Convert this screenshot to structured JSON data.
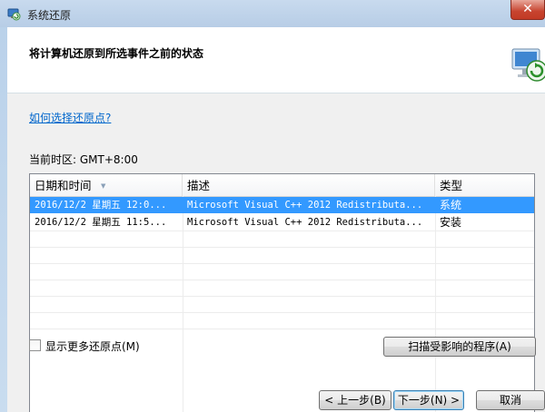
{
  "window": {
    "title": "系统还原",
    "close_glyph": "✕"
  },
  "header": {
    "title": "将计算机还原到所选事件之前的状态",
    "icon": "system-restore-icon"
  },
  "help_link": "如何选择还原点?",
  "timezone_label": "当前时区: GMT+8:00",
  "table": {
    "columns": [
      "日期和时间",
      "描述",
      "类型"
    ],
    "rows": [
      {
        "date": "2016/12/2 星期五 12:0...",
        "description": "Microsoft Visual C++ 2012 Redistributa...",
        "type": "系统",
        "selected": true
      },
      {
        "date": "2016/12/2 星期五 11:5...",
        "description": "Microsoft Visual C++ 2012 Redistributa...",
        "type": "安装",
        "selected": false
      }
    ]
  },
  "show_more_label": "显示更多还原点(M)",
  "show_more_checked": false,
  "buttons": {
    "scan": "扫描受影响的程序(A)",
    "back": "< 上一步(B)",
    "next": "下一步(N) >",
    "cancel": "取消"
  },
  "colors": {
    "selection": "#3399ff",
    "link": "#0066cc",
    "close": "#c7432f"
  }
}
